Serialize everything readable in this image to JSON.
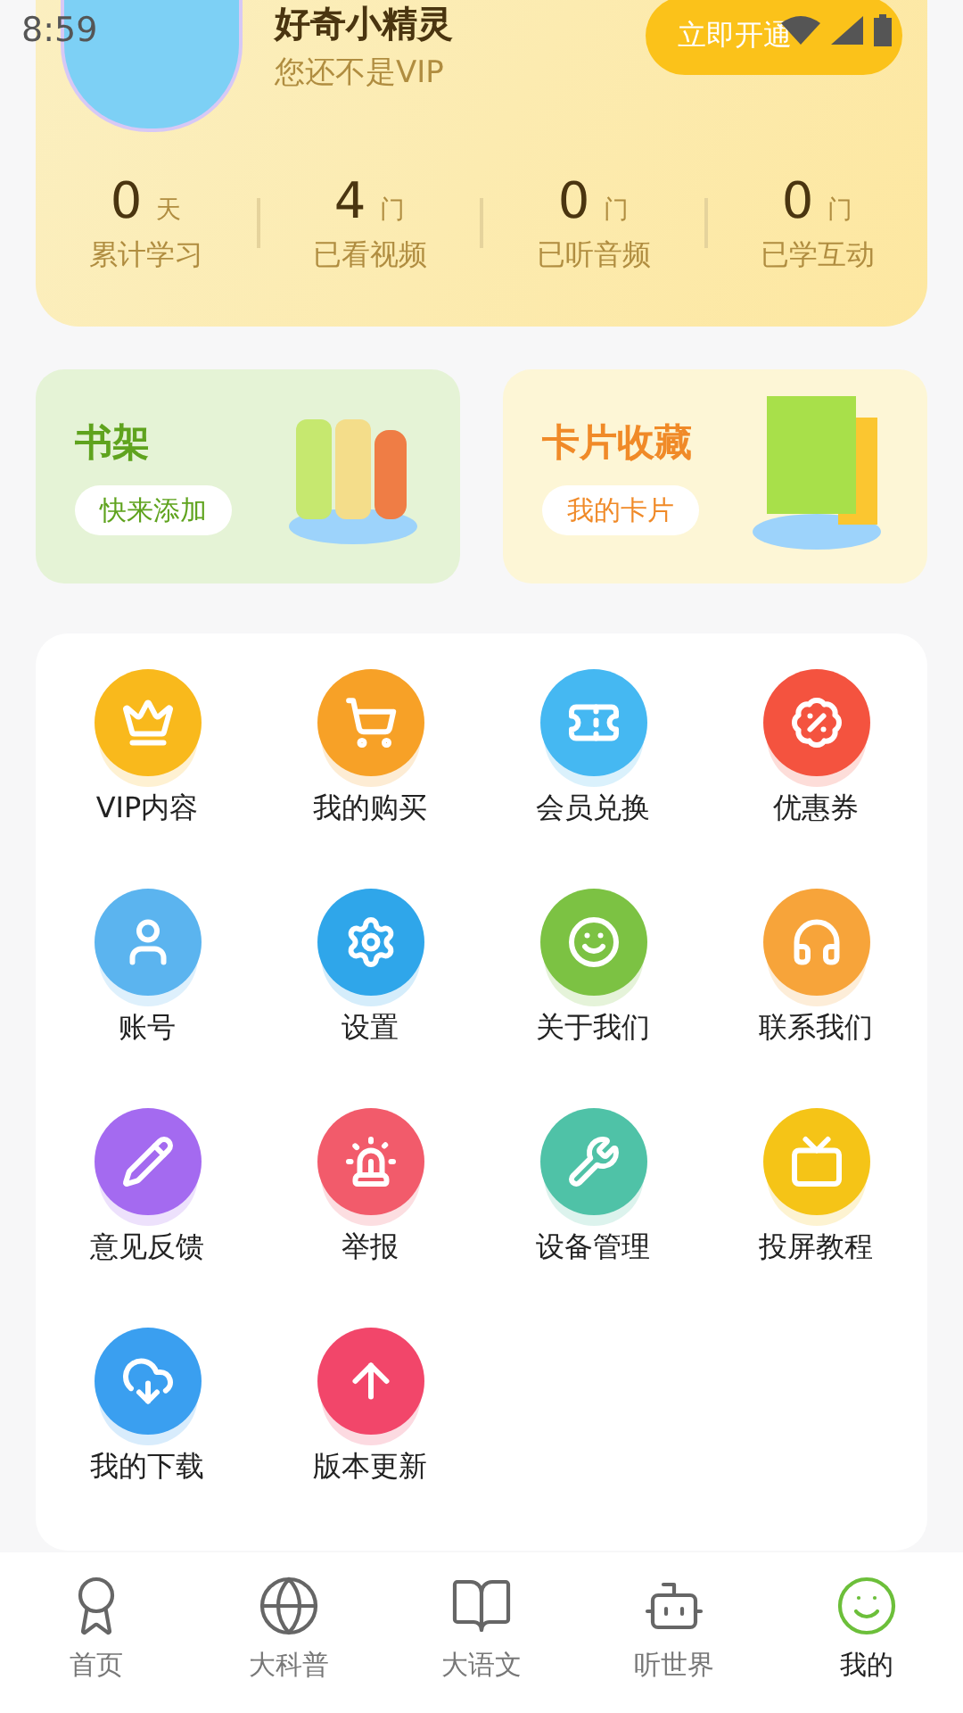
{
  "status_bar": {
    "time": "8:59"
  },
  "profile": {
    "name": "好奇小精灵",
    "subtitle": "您还不是VIP",
    "vip_button": "立即开通"
  },
  "stats": [
    {
      "value": "0",
      "unit": "天",
      "label": "累计学习"
    },
    {
      "value": "4",
      "unit": "门",
      "label": "已看视频"
    },
    {
      "value": "0",
      "unit": "门",
      "label": "已听音频"
    },
    {
      "value": "0",
      "unit": "门",
      "label": "已学互动"
    }
  ],
  "banners": [
    {
      "kind": "shelf",
      "title": "书架",
      "button": "快来添加"
    },
    {
      "kind": "cards",
      "title": "卡片收藏",
      "button": "我的卡片"
    }
  ],
  "menu": [
    {
      "kind": "vip",
      "label": "VIP内容",
      "color": "#f9b91c"
    },
    {
      "kind": "cart",
      "label": "我的购买",
      "color": "#f7a127"
    },
    {
      "kind": "ticket",
      "label": "会员兑换",
      "color": "#45b8f2"
    },
    {
      "kind": "coupon",
      "label": "优惠券",
      "color": "#f4533f"
    },
    {
      "kind": "user",
      "label": "账号",
      "color": "#5bb4ef"
    },
    {
      "kind": "gear",
      "label": "设置",
      "color": "#2fa6ea"
    },
    {
      "kind": "mascot",
      "label": "关于我们",
      "color": "#7cc243"
    },
    {
      "kind": "headset",
      "label": "联系我们",
      "color": "#f7a43a"
    },
    {
      "kind": "pen",
      "label": "意见反馈",
      "color": "#a46af0"
    },
    {
      "kind": "alarm",
      "label": "举报",
      "color": "#f25b6b"
    },
    {
      "kind": "wrench",
      "label": "设备管理",
      "color": "#4fc2a7"
    },
    {
      "kind": "tv",
      "label": "投屏教程",
      "color": "#f5c417"
    },
    {
      "kind": "download",
      "label": "我的下载",
      "color": "#3a9ff0"
    },
    {
      "kind": "upload",
      "label": "版本更新",
      "color": "#f2466a"
    }
  ],
  "tabs": [
    {
      "kind": "home",
      "label": "首页",
      "selected": false
    },
    {
      "kind": "planet",
      "label": "大科普",
      "selected": false
    },
    {
      "kind": "book",
      "label": "大语文",
      "selected": false
    },
    {
      "kind": "robot",
      "label": "听世界",
      "selected": false
    },
    {
      "kind": "mascot",
      "label": "我的",
      "selected": true
    }
  ]
}
